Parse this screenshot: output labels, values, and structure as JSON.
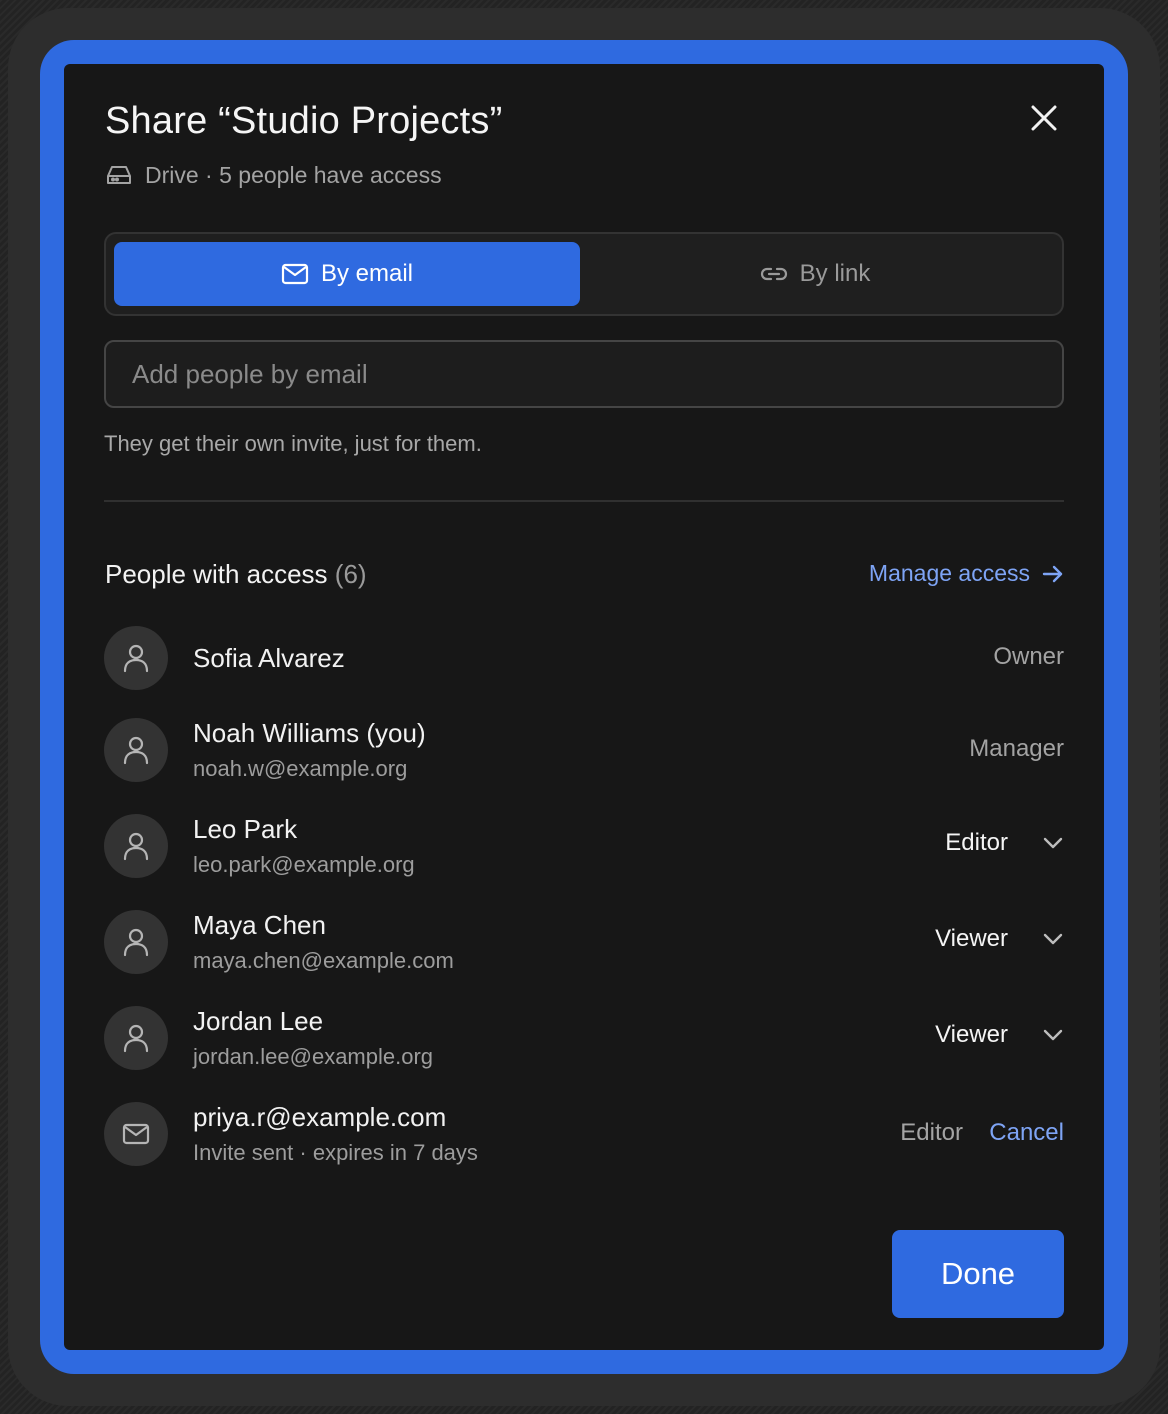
{
  "dialog": {
    "title": "Share “Studio Projects”",
    "subtitle": "Drive · 5 people have access"
  },
  "tabs": [
    {
      "label": "By email",
      "icon": "mail-icon",
      "active": true
    },
    {
      "label": "By link",
      "icon": "link-icon",
      "active": false
    }
  ],
  "invite": {
    "placeholder": "Add people by email",
    "hint": "They get their own invite, just for them."
  },
  "access": {
    "title": "People with access",
    "count": "(6)",
    "manage_label": "Manage access"
  },
  "people": [
    {
      "name": "Sofia Alvarez",
      "email": "",
      "role": "Owner"
    },
    {
      "name": "Noah Williams (you)",
      "email": "noah.w@example.org",
      "role": "Manager"
    },
    {
      "name": "Leo Park",
      "email": "leo.park@example.org",
      "role": "Editor"
    },
    {
      "name": "Maya Chen",
      "email": "maya.chen@example.com",
      "role": "Viewer"
    },
    {
      "name": "Jordan Lee",
      "email": "jordan.lee@example.org",
      "role": "Viewer"
    }
  ],
  "pending": {
    "email": "priya.r@example.com",
    "status": "Invite sent · expires in 7 days",
    "role": "Editor",
    "cancel_label": "Cancel"
  },
  "footer": {
    "done_label": "Done"
  },
  "colors": {
    "accent": "#2f6ae0",
    "link": "#7ea4f5",
    "dialog_bg": "#171717"
  }
}
